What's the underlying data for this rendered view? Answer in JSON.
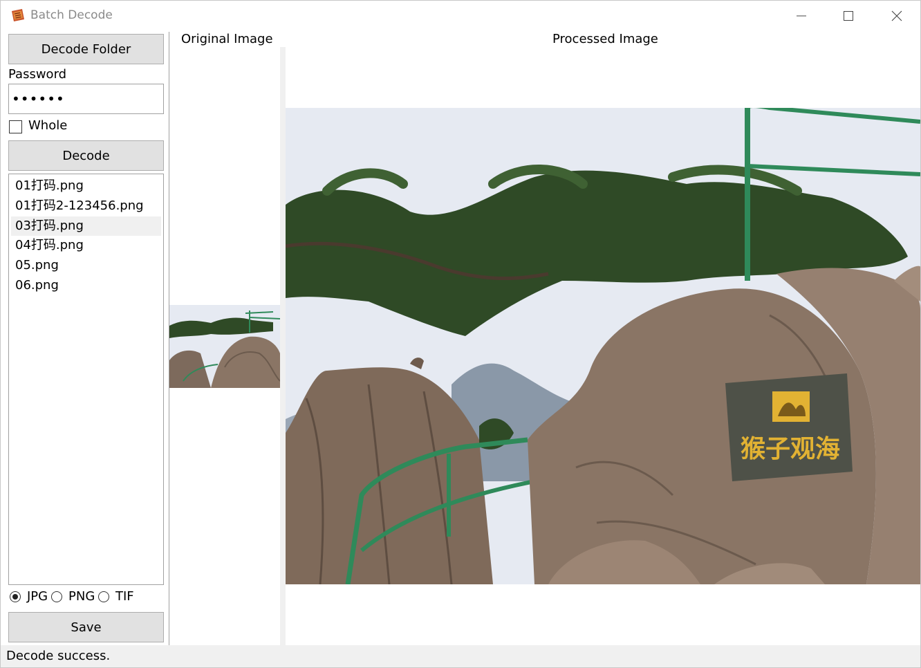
{
  "window": {
    "title": "Batch Decode"
  },
  "left_panel": {
    "decode_folder_label": "Decode Folder",
    "password_label": "Password",
    "password_value": "••••••",
    "whole_label": "Whole",
    "whole_checked": false,
    "decode_label": "Decode",
    "files": [
      {
        "name": "01打码.png",
        "selected": false
      },
      {
        "name": "01打码2-123456.png",
        "selected": false
      },
      {
        "name": "03打码.png",
        "selected": true
      },
      {
        "name": "04打码.png",
        "selected": false
      },
      {
        "name": "05.png",
        "selected": false
      },
      {
        "name": "06.png",
        "selected": false
      }
    ],
    "formats": [
      {
        "label": "JPG",
        "checked": true
      },
      {
        "label": "PNG",
        "checked": false
      },
      {
        "label": "TIF",
        "checked": false
      }
    ],
    "save_label": "Save"
  },
  "images": {
    "original_header": "Original Image",
    "processed_header": "Processed Image",
    "sign_text": "猴子观海"
  },
  "status": {
    "text": "Decode success."
  },
  "colors": {
    "button_bg": "#e1e1e1",
    "status_bg": "#f0f0f0",
    "sky": "#e6eaf2",
    "pine": "#2f4a26",
    "rock": "#8a7565",
    "railing": "#2f8a5a",
    "sign_plate": "#4e5148",
    "sign_text": "#e2b233"
  }
}
